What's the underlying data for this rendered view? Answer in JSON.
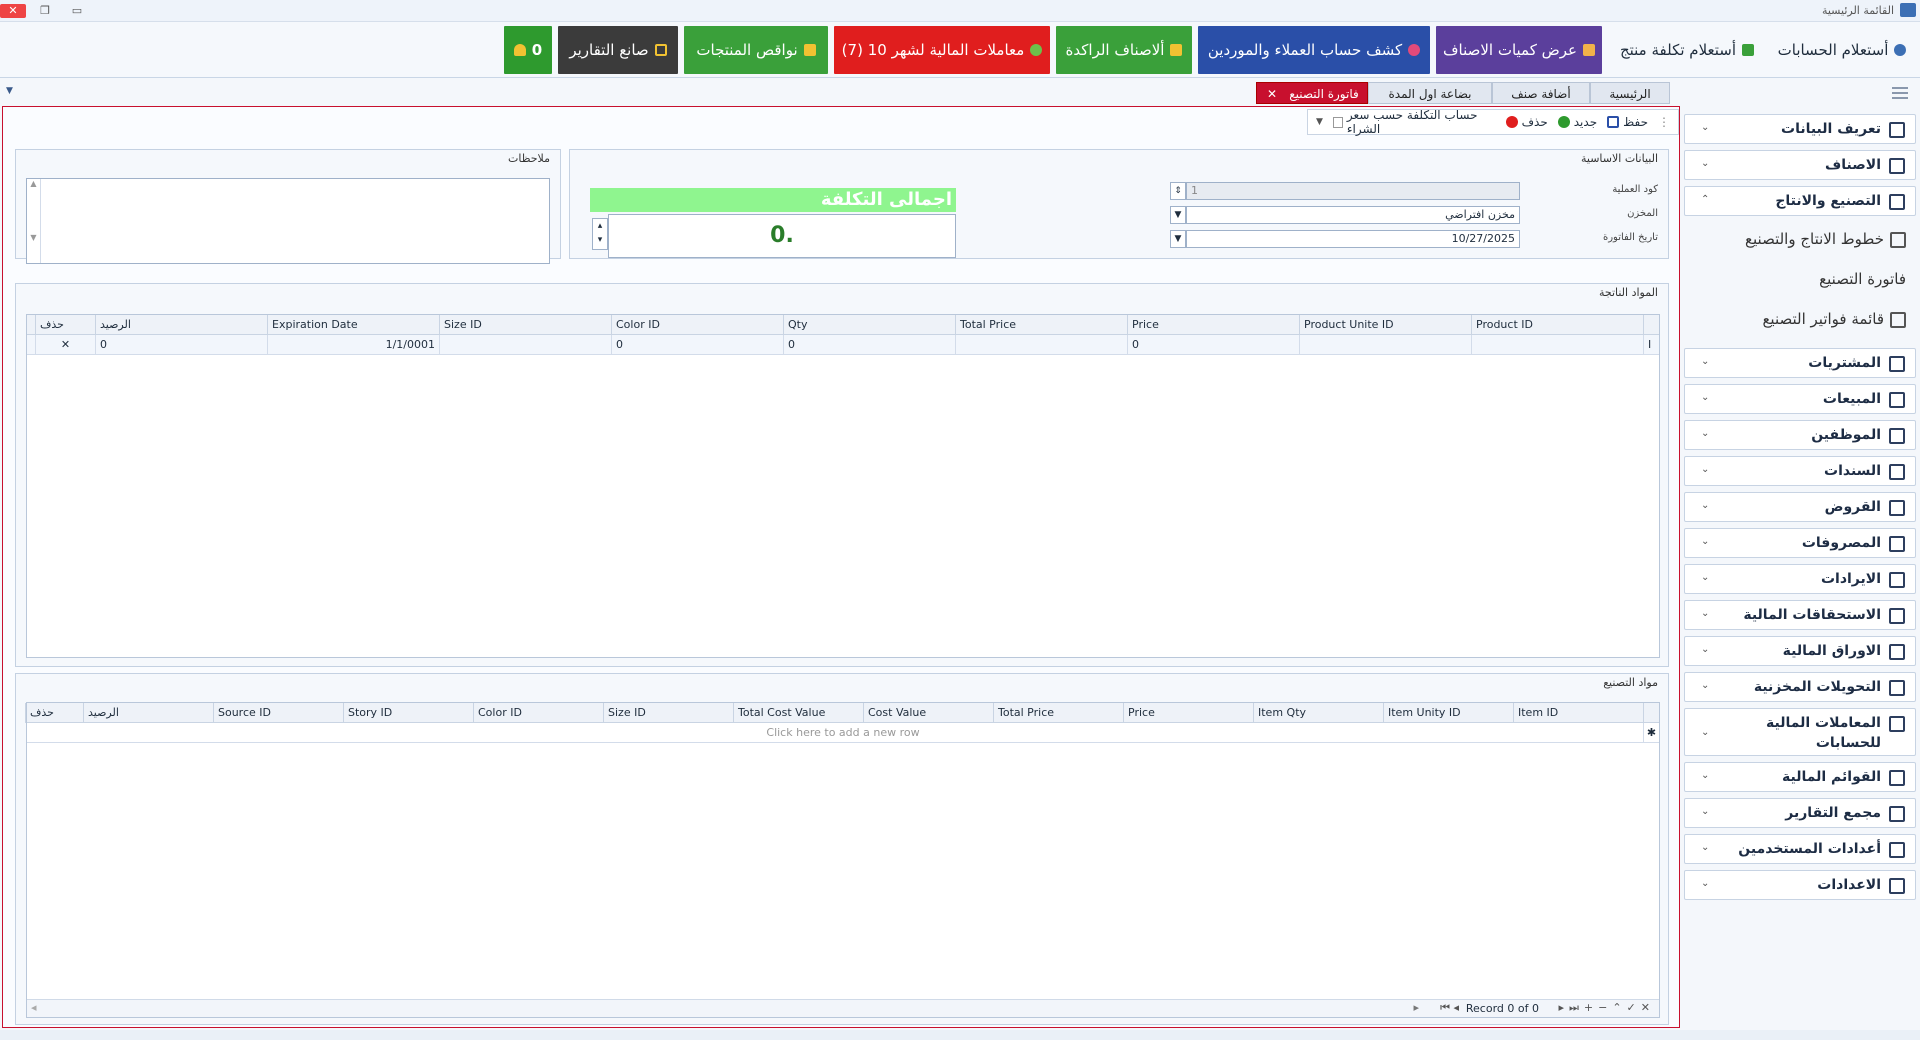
{
  "window": {
    "title": "القائمة الرئيسية"
  },
  "toolbar": {
    "buttons": [
      {
        "label": "أستعلام الحسابات",
        "bg": "transparent",
        "fg": "#1f2d3d",
        "icon": "info-icon"
      },
      {
        "label": "أستعلام تكلفة منتج",
        "bg": "transparent",
        "fg": "#1f2d3d",
        "icon": "money-icon"
      },
      {
        "label": "عرض كميات الاصناف",
        "bg": "#5b3f9c",
        "fg": "#ffffff",
        "icon": "boxes-icon"
      },
      {
        "label": "كشف حساب العملاء والموردين",
        "bg": "#2a4fa8",
        "fg": "#ffffff",
        "icon": "pie-icon"
      },
      {
        "label": "ألاصناف الراكدة",
        "bg": "#3aa03a",
        "fg": "#ffffff",
        "icon": "package-icon"
      },
      {
        "label": "معاملات المالية لشهر 10  (7)",
        "bg": "#e01e1e",
        "fg": "#ffffff",
        "icon": "transactions-icon"
      },
      {
        "label": "نواقص المنتجات",
        "bg": "#3aa03a",
        "fg": "#ffffff",
        "icon": "shortage-icon"
      },
      {
        "label": "صانع التقارير",
        "bg": "#3b3b3b",
        "fg": "#ffffff",
        "icon": "report-icon"
      },
      {
        "label": "0",
        "bg": "#2e9a2e",
        "fg": "#ffffff",
        "icon": "bell-icon"
      }
    ]
  },
  "tabs": [
    {
      "label": "الرئيسية",
      "active": false
    },
    {
      "label": "أضافة صنف",
      "active": false
    },
    {
      "label": "بضاعة اول المدة",
      "active": false
    },
    {
      "label": "فاتورة التصنيع",
      "active": true
    }
  ],
  "actions": {
    "save": "حفظ",
    "new": "جديد",
    "delete": "حذف",
    "cost_by_purchase": "حساب التكلفة حسب سعر الشراء"
  },
  "basic": {
    "title": "البيانات الاساسية",
    "op_code_label": "كود العملية",
    "op_code": "1",
    "store_label": "المخزن",
    "store": "مخزن افتراضي",
    "date_label": "تاريخ الفاتورة",
    "date": "10/27/2025",
    "cost_label": "اجمالى التكلفة",
    "cost_value": "0."
  },
  "notes": {
    "title": "ملاحظات"
  },
  "products": {
    "title": "المواد الناتجة",
    "columns": [
      "Product ID",
      "Product Unite ID",
      "Price",
      "Total Price",
      "Qty",
      "Color ID",
      "Size ID",
      "Expiration Date",
      "الرصيد",
      "حذف"
    ],
    "rows": [
      [
        "",
        "",
        "0",
        "",
        "0",
        "0",
        "",
        "1/1/0001",
        "0",
        "✕"
      ]
    ]
  },
  "materials": {
    "title": "مواد التصنيع",
    "columns": [
      "Item ID",
      "Item Unity ID",
      "Item Qty",
      "Price",
      "Total Price",
      "Cost Value",
      "Total Cost Value",
      "Size ID",
      "Color ID",
      "Story ID",
      "Source ID",
      "الرصيد",
      "حذف"
    ],
    "new_row": "Click here to add a new row",
    "record": "Record 0 of 0"
  },
  "sidebar": {
    "groups": [
      {
        "label": "تعريف البيانات",
        "icon": "data-icon"
      },
      {
        "label": "الاصناف",
        "icon": "items-icon"
      },
      {
        "label": "التصنيع والانتاج",
        "icon": "factory-icon",
        "expanded": true
      },
      {
        "label": "المشتريات",
        "icon": "cart-icon"
      },
      {
        "label": "المبيعات",
        "icon": "sales-icon"
      },
      {
        "label": "الموظفين",
        "icon": "employees-icon"
      },
      {
        "label": "السندات",
        "icon": "vouchers-icon"
      },
      {
        "label": "القروض",
        "icon": "loans-icon"
      },
      {
        "label": "المصروفات",
        "icon": "expenses-icon"
      },
      {
        "label": "الايرادات",
        "icon": "revenue-icon"
      },
      {
        "label": "الاستحقاقات المالية",
        "icon": "dollar-icon"
      },
      {
        "label": "الاوراق المالية",
        "icon": "papers-icon"
      },
      {
        "label": "التحويلات المخزنية",
        "icon": "transfer-icon"
      },
      {
        "label": "المعاملات المالية للحسابات",
        "icon": "gear-money-icon"
      },
      {
        "label": "القوائم المالية",
        "icon": "lists-icon"
      },
      {
        "label": "مجمع التقارير",
        "icon": "reports-icon"
      },
      {
        "label": "أعدادات المستخدمين",
        "icon": "users-icon"
      },
      {
        "label": "الاعدادات",
        "icon": "settings-icon"
      }
    ],
    "subitems": [
      {
        "label": "خطوط الانتاج والتصنيع",
        "icon": "line-icon"
      },
      {
        "label": "فاتورة التصنيع",
        "icon": ""
      },
      {
        "label": "قائمة فواتير التصنيع",
        "icon": "tools-icon"
      }
    ]
  }
}
